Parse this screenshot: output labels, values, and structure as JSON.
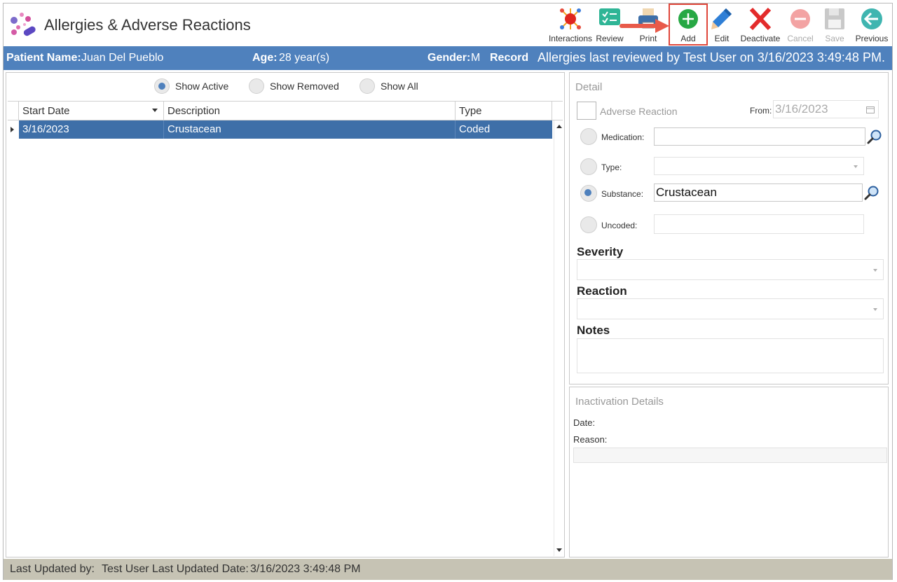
{
  "window": {
    "title": "Allergies & Adverse Reactions",
    "logo_icon": "pills-logo-icon"
  },
  "toolbar": {
    "interactions": "Interactions",
    "review": "Review",
    "print": "Print",
    "add": "Add",
    "edit": "Edit",
    "deactivate": "Deactivate",
    "cancel": "Cancel",
    "save": "Save",
    "previous": "Previous"
  },
  "patient": {
    "name_label": "Patient Name:",
    "name": "Juan Del Pueblo",
    "age_label": "Age:",
    "age": "28 year(s)",
    "gender_label": "Gender:",
    "gender": "M",
    "record_label": "Record",
    "reviewed": "Allergies last reviewed by Test User on 3/16/2023 3:49:48 PM."
  },
  "filters": {
    "show_active": "Show Active",
    "show_removed": "Show Removed",
    "show_all": "Show All",
    "selected": "show_active"
  },
  "grid": {
    "columns": [
      "Start Date",
      "Description",
      "Type"
    ],
    "rows": [
      {
        "start_date": "3/16/2023",
        "description": "Crustacean",
        "type": "Coded"
      }
    ]
  },
  "detail": {
    "title": "Detail",
    "adverse_reaction": "Adverse Reaction",
    "from_label": "From:",
    "from_value": "3/16/2023",
    "medication_label": "Medication:",
    "medication_value": "",
    "type_label": "Type:",
    "type_value": "",
    "substance_label": "Substance:",
    "substance_value": "Crustacean",
    "uncoded_label": "Uncoded:",
    "uncoded_value": "",
    "severity_label": "Severity",
    "reaction_label": "Reaction",
    "notes_label": "Notes"
  },
  "inactivation": {
    "title": "Inactivation Details",
    "date_label": "Date:",
    "reason_label": "Reason:"
  },
  "footer": {
    "updated_by_label": "Last Updated by:",
    "updated_by": "Test User",
    "updated_date_label": "Last Updated Date:",
    "updated_date": "3/16/2023 3:49:48 PM"
  },
  "colors": {
    "banner": "#4f81bd",
    "selected_row": "#3e6fa8",
    "highlight": "#e0463a",
    "footer": "#c6c3b4"
  }
}
